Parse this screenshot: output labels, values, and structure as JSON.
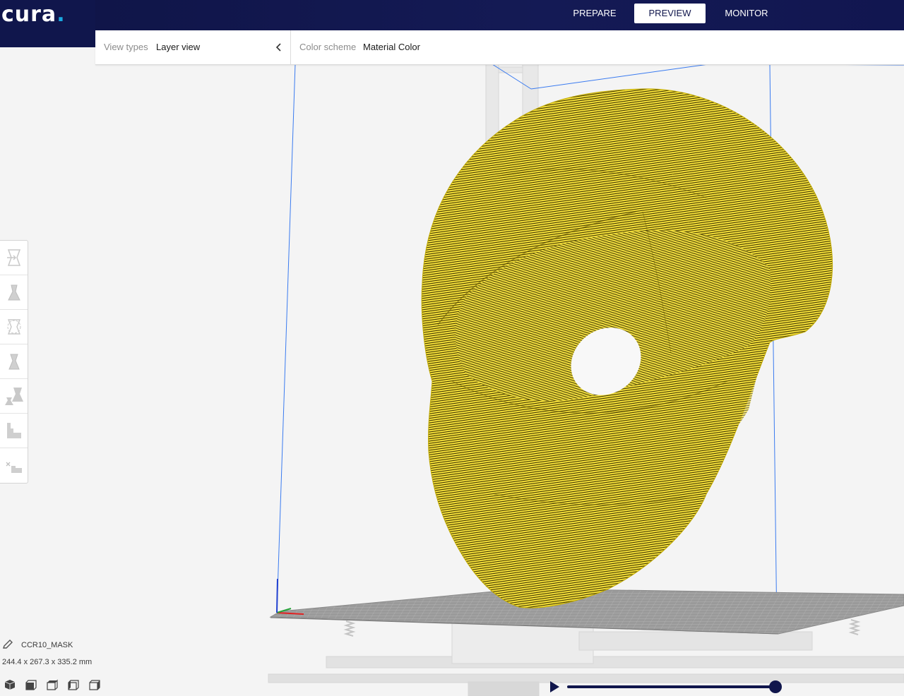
{
  "app": {
    "logo_text": "cura",
    "logo_dot": "."
  },
  "nav": {
    "tabs": [
      {
        "label": "PREPARE",
        "active": false
      },
      {
        "label": "PREVIEW",
        "active": true
      },
      {
        "label": "MONITOR",
        "active": false
      }
    ]
  },
  "viewbar": {
    "view_types_label": "View types",
    "view_types_value": "Layer view",
    "color_scheme_label": "Color scheme",
    "color_scheme_value": "Material Color"
  },
  "tools": [
    {
      "icon": "move-icon"
    },
    {
      "icon": "scale-icon"
    },
    {
      "icon": "rotate-icon"
    },
    {
      "icon": "mirror-icon"
    },
    {
      "icon": "per-model-settings-icon"
    },
    {
      "icon": "support-blocker-icon"
    },
    {
      "icon": "custom-support-icon"
    }
  ],
  "object": {
    "name": "CCR10_MASK",
    "dimensions": "244.4 x 267.3 x 335.2 mm"
  },
  "camera_views": [
    "3d-view-icon",
    "front-view-icon",
    "top-view-icon",
    "left-view-icon",
    "right-view-icon"
  ],
  "colors": {
    "header": "#10164c",
    "accent": "#19a9e1",
    "material": "#f5e03a"
  },
  "layer_slider": {
    "value": 1.0
  }
}
